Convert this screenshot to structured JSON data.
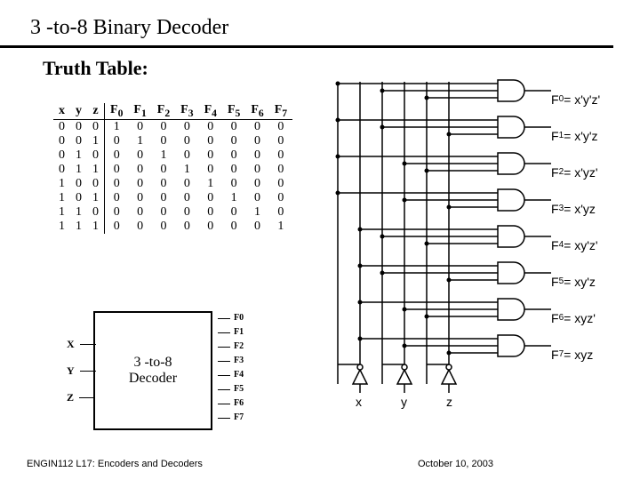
{
  "title": "3 -to-8  Binary Decoder",
  "subtitle": "Truth Table:",
  "truth_table": {
    "headers": [
      "x",
      "y",
      "z",
      "F0",
      "F1",
      "F2",
      "F3",
      "F4",
      "F5",
      "F6",
      "F7"
    ],
    "rows": [
      [
        "0",
        "0",
        "0",
        "1",
        "0",
        "0",
        "0",
        "0",
        "0",
        "0",
        "0"
      ],
      [
        "0",
        "0",
        "1",
        "0",
        "1",
        "0",
        "0",
        "0",
        "0",
        "0",
        "0"
      ],
      [
        "0",
        "1",
        "0",
        "0",
        "0",
        "1",
        "0",
        "0",
        "0",
        "0",
        "0"
      ],
      [
        "0",
        "1",
        "1",
        "0",
        "0",
        "0",
        "1",
        "0",
        "0",
        "0",
        "0"
      ],
      [
        "1",
        "0",
        "0",
        "0",
        "0",
        "0",
        "0",
        "1",
        "0",
        "0",
        "0"
      ],
      [
        "1",
        "0",
        "1",
        "0",
        "0",
        "0",
        "0",
        "0",
        "1",
        "0",
        "0"
      ],
      [
        "1",
        "1",
        "0",
        "0",
        "0",
        "0",
        "0",
        "0",
        "0",
        "1",
        "0"
      ],
      [
        "1",
        "1",
        "1",
        "0",
        "0",
        "0",
        "0",
        "0",
        "0",
        "0",
        "1"
      ]
    ]
  },
  "block": {
    "label": "3 -to-8\nDecoder",
    "inputs": [
      "X",
      "Y",
      "Z"
    ],
    "outputs": [
      "F0",
      "F1",
      "F2",
      "F3",
      "F4",
      "F5",
      "F6",
      "F7"
    ]
  },
  "gate_outputs": [
    {
      "name": "F0",
      "expr": "x'y'z'"
    },
    {
      "name": "F1",
      "expr": "x'y'z"
    },
    {
      "name": "F2",
      "expr": "x'yz'"
    },
    {
      "name": "F3",
      "expr": "x'yz"
    },
    {
      "name": "F4",
      "expr": "xy'z'"
    },
    {
      "name": "F5",
      "expr": "xy'z"
    },
    {
      "name": "F6",
      "expr": "xyz'"
    },
    {
      "name": "F7",
      "expr": "xyz"
    }
  ],
  "circuit_inputs": [
    "x",
    "y",
    "z"
  ],
  "footer": {
    "left": "ENGIN112 L17: Encoders and Decoders",
    "right": "October 10, 2003"
  }
}
